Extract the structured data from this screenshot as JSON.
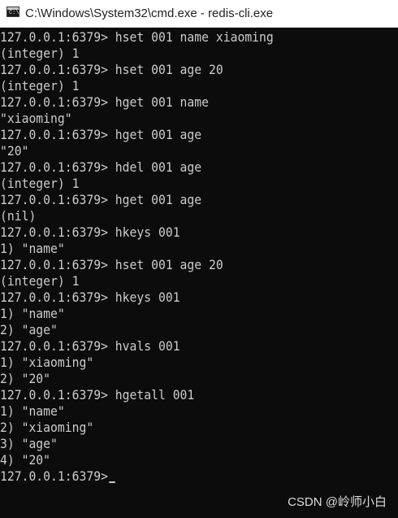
{
  "window": {
    "title": "C:\\Windows\\System32\\cmd.exe - redis-cli.exe",
    "icon": "cmd-icon",
    "icon_text": "C:\\"
  },
  "console": {
    "lines": [
      "127.0.0.1:6379> hset 001 name xiaoming",
      "(integer) 1",
      "127.0.0.1:6379> hset 001 age 20",
      "(integer) 1",
      "127.0.0.1:6379> hget 001 name",
      "\"xiaoming\"",
      "127.0.0.1:6379> hget 001 age",
      "\"20\"",
      "127.0.0.1:6379> hdel 001 age",
      "(integer) 1",
      "127.0.0.1:6379> hget 001 age",
      "(nil)",
      "127.0.0.1:6379> hkeys 001",
      "1) \"name\"",
      "127.0.0.1:6379> hset 001 age 20",
      "(integer) 1",
      "127.0.0.1:6379> hkeys 001",
      "1) \"name\"",
      "2) \"age\"",
      "127.0.0.1:6379> hvals 001",
      "1) \"xiaoming\"",
      "2) \"20\"",
      "127.0.0.1:6379> hgetall 001",
      "1) \"name\"",
      "2) \"xiaoming\"",
      "3) \"age\"",
      "4) \"20\"",
      "127.0.0.1:6379>"
    ]
  },
  "watermark": "CSDN @岭师小白",
  "colors": {
    "console_bg": "#0c0c0c",
    "console_text": "#cccccc",
    "titlebar_bg": "#ffffff"
  }
}
